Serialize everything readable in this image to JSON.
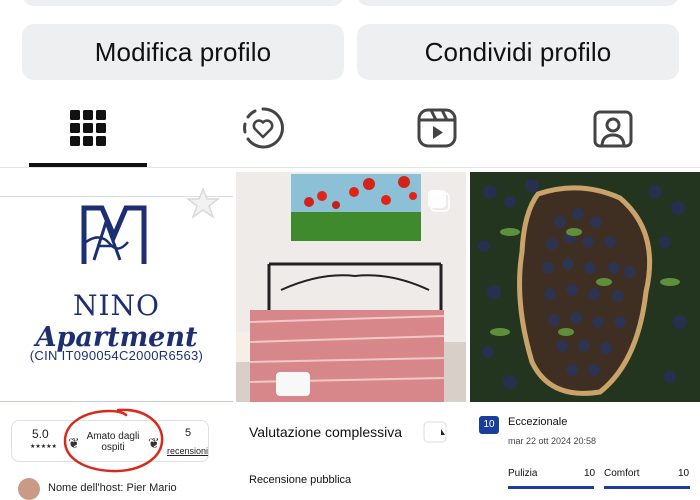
{
  "actions": {
    "edit_label": "Modifica profilo",
    "share_label": "Condividi profilo"
  },
  "tabs": [
    {
      "name": "grid",
      "icon": "grid-icon",
      "active": true
    },
    {
      "name": "highlights",
      "icon": "heart-circle-icon",
      "active": false
    },
    {
      "name": "reels",
      "icon": "reels-icon",
      "active": false
    },
    {
      "name": "tagged",
      "icon": "tagged-person-icon",
      "active": false
    }
  ],
  "posts": {
    "nino": {
      "brand_first": "NINO",
      "brand_second": "Apartment",
      "cin": "(CIN IT090054C2000R6563)",
      "rating_score": "5.0",
      "rating_stars": "★★★★★",
      "badge_label": "Amato dagli ospiti",
      "reviews_count": "5",
      "reviews_label": "recensioni",
      "host_line": "Nome dell'host: Pier Mario"
    },
    "room": {
      "title": "Valutazione complessiva",
      "public_review": "Recensione pubblica"
    },
    "review": {
      "score": "10",
      "label": "Eccezionale",
      "date": "mar 22 ott 2024 20:58",
      "metrics": [
        {
          "label": "Pulizia",
          "value": "10"
        },
        {
          "label": "Comfort",
          "value": "10"
        }
      ]
    }
  },
  "colors": {
    "brand_navy": "#1c2f73",
    "booking_blue": "#1a3e9a",
    "circle_annotation": "#d62a1e",
    "button_bg": "#eeeff1"
  }
}
